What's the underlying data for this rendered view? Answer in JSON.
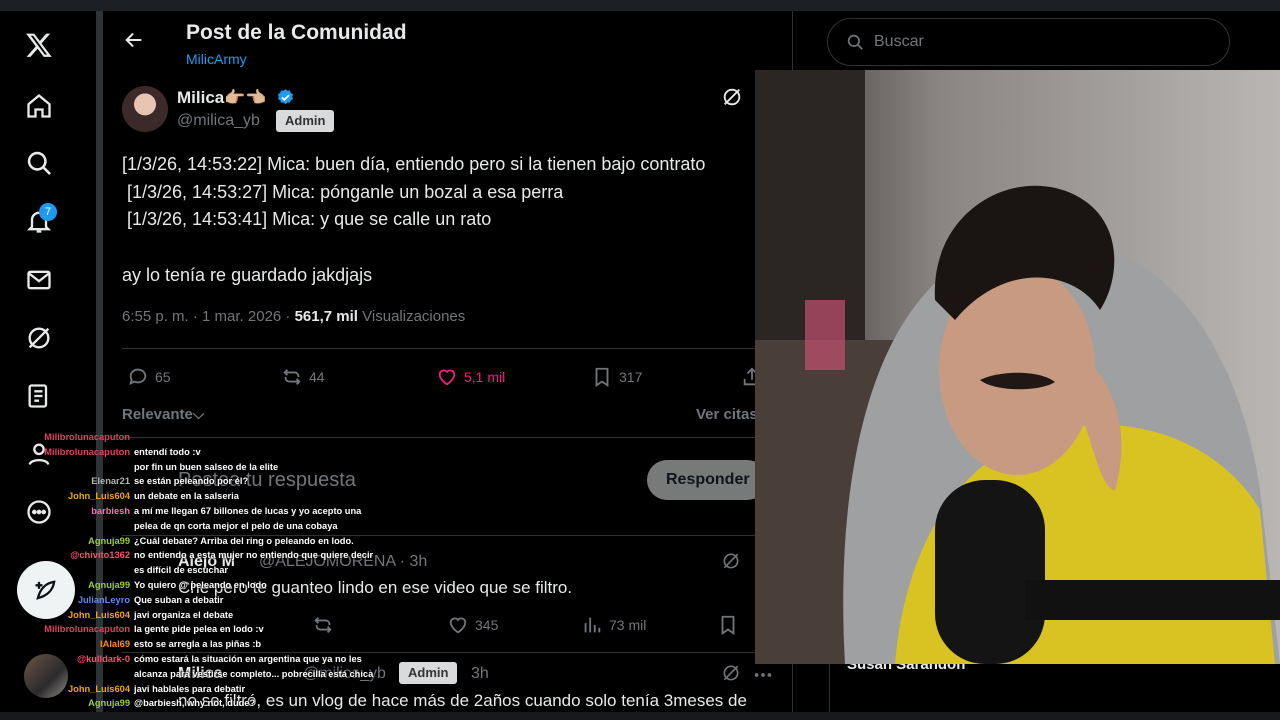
{
  "header": {
    "title": "Post de la Comunidad",
    "subtitle": "MilicArmy"
  },
  "nav": {
    "notifications_badge": "7"
  },
  "post": {
    "name": "Milica👉🏼👈🏼",
    "handle": "@milica_yb",
    "admin_label": "Admin",
    "lines": [
      "[1/3/26, 14:53:22] Mica: buen día, entiendo pero si la tienen bajo contrato",
      " [1/3/26, 14:53:27] Mica: pónganle un bozal a esa perra",
      " [1/3/26, 14:53:41] Mica: y que se calle un rato"
    ],
    "extra": "ay lo tenía re guardado jakdjajs",
    "time": "6:55 p. m. · 1 mar. 2026 ·",
    "views_count": "561,7 mil",
    "views_label": "Visualizaciones",
    "replies": "65",
    "reposts": "44",
    "likes": "5,1 mil",
    "bookmarks": "317"
  },
  "sort": {
    "label": "Relevante",
    "quotes": "Ver citas"
  },
  "reply_box": {
    "placeholder": "Postea tu respuesta",
    "button": "Responder"
  },
  "replies": [
    {
      "name": "Alejo M",
      "handle": "@ALEJOMORENA · 3h",
      "text": "Che pero te guanteo lindo en ese video que se filtro.",
      "reposts": "",
      "likes": "345",
      "views": "73 mil"
    },
    {
      "name": "Milica",
      "handle": "@milica_yb",
      "admin_label": "Admin",
      "time": "3h",
      "text": "no se filtró, es un vlog de hace más de 2años cuando solo tenía 3meses de"
    }
  ],
  "search": {
    "placeholder": "Buscar"
  },
  "trending": {
    "name": "Susan Sarandon"
  },
  "chat": [
    {
      "user": "Milibrolunacaputon",
      "msg": "",
      "color": "#e0405e"
    },
    {
      "user": "Milibrolunacaputon",
      "msg": "entendí todo :v",
      "color": "#e0405e"
    },
    {
      "user": "",
      "msg": "por fin un buen salseo de la elite",
      "color": "#6c5ce7"
    },
    {
      "user": "Elenar21",
      "msg": "se están peleando por él?",
      "color": "#b4b4b4"
    },
    {
      "user": "John_Luis604",
      "msg": "un debate en la salseria",
      "color": "#f0a500"
    },
    {
      "user": "barbiesh",
      "msg": "a mí me llegan 67 billones de lucas y yo acepto una",
      "color": "#ff69b4"
    },
    {
      "user": "",
      "msg": "pelea de qn corta mejor el pelo de una cobaya",
      "color": "#ff69b4"
    },
    {
      "user": "Agnuja99",
      "msg": "¿Cuál debate? Arriba del ring o peleando en lodo.",
      "color": "#9acd32"
    },
    {
      "user": "@chivito1362",
      "msg": "no entiendo a esta mujer no entiendo que quiere decir",
      "color": "#ff4d6d"
    },
    {
      "user": "",
      "msg": "es difícil de escuchar",
      "color": "#ff4d6d"
    },
    {
      "user": "Agnuja99",
      "msg": "Yo quiero @ peleando en lodo",
      "color": "#9acd32"
    },
    {
      "user": "JulianLeyro",
      "msg": "Que suban a debatir",
      "color": "#5b8def"
    },
    {
      "user": "John_Luis604",
      "msg": "javi organiza el debate",
      "color": "#f0a500"
    },
    {
      "user": "Milibrolunacaputon",
      "msg": "la gente pide pelea en lodo :v",
      "color": "#e0405e"
    },
    {
      "user": "lAlal69",
      "msg": "esto se arregla a las piñas :b",
      "color": "#ff8c00"
    },
    {
      "user": "@kulldark-0",
      "msg": "cómo estará la situación en argentina que ya no les",
      "color": "#ff4d6d"
    },
    {
      "user": "",
      "msg": "alcanza para vestirse completo... pobrecilla está chica",
      "color": "#ff4d6d"
    },
    {
      "user": "John_Luis604",
      "msg": "javi hablales para debatir",
      "color": "#f0a500"
    },
    {
      "user": "Agnuja99",
      "msg": "@barbiesh, why not, dude?",
      "color": "#9acd32"
    }
  ]
}
